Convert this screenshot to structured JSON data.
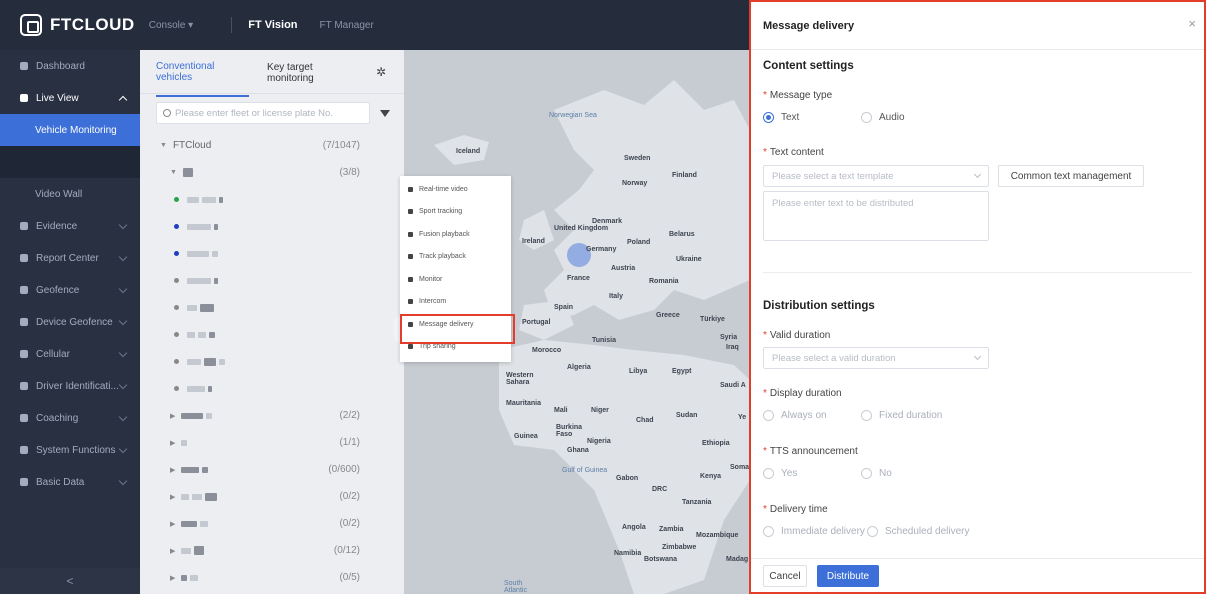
{
  "app": {
    "brand": "FTCLOUD",
    "console_label": "Console ▾",
    "nav_active": "FT Vision",
    "nav_other": "FT Manager"
  },
  "sidebar": {
    "items": [
      {
        "label": "Dashboard"
      },
      {
        "label": "Live View"
      },
      {
        "label": "Vehicle Monitoring"
      },
      {
        "label": "Video Wall"
      },
      {
        "label": "Evidence"
      },
      {
        "label": "Report Center"
      },
      {
        "label": "Geofence"
      },
      {
        "label": "Device Geofence"
      },
      {
        "label": "Cellular"
      },
      {
        "label": "Driver Identificati..."
      },
      {
        "label": "Coaching"
      },
      {
        "label": "System Functions"
      },
      {
        "label": "Basic Data"
      }
    ],
    "collapse_glyph": "<"
  },
  "vehicles": {
    "tabs": [
      "Conventional vehicles",
      "Key target monitoring"
    ],
    "search_placeholder": "Please enter fleet or license plate No.",
    "root": {
      "label": "FTCloud",
      "count": "(7/1047)"
    },
    "group_count": "(3/8)",
    "subgroups": [
      "(2/2)",
      "(1/1)",
      "(0/600)",
      "(0/2)",
      "(0/2)",
      "(0/12)",
      "(0/5)"
    ]
  },
  "context_menu": {
    "items": [
      {
        "label": "Real-time video"
      },
      {
        "label": "Sport tracking"
      },
      {
        "label": "Fusion playback"
      },
      {
        "label": "Track playback"
      },
      {
        "label": "Monitor"
      },
      {
        "label": "Intercom"
      },
      {
        "label": "Message delivery"
      },
      {
        "label": "Trip sharing"
      }
    ]
  },
  "map": {
    "labels": [
      {
        "text": "Norwegian Sea",
        "kind": "sea"
      },
      {
        "text": "Iceland",
        "kind": "land"
      },
      {
        "text": "Sweden",
        "kind": "land"
      },
      {
        "text": "Finland",
        "kind": "land"
      },
      {
        "text": "Norway",
        "kind": "land"
      },
      {
        "text": "United Kingdom",
        "kind": "land"
      },
      {
        "text": "Denmark",
        "kind": "land"
      },
      {
        "text": "Ireland",
        "kind": "land"
      },
      {
        "text": "Belarus",
        "kind": "land"
      },
      {
        "text": "Poland",
        "kind": "land"
      },
      {
        "text": "Germany",
        "kind": "land"
      },
      {
        "text": "Ukraine",
        "kind": "land"
      },
      {
        "text": "Austria",
        "kind": "land"
      },
      {
        "text": "France",
        "kind": "land"
      },
      {
        "text": "Romania",
        "kind": "land"
      },
      {
        "text": "Italy",
        "kind": "land"
      },
      {
        "text": "Spain",
        "kind": "land"
      },
      {
        "text": "Portugal",
        "kind": "land"
      },
      {
        "text": "Greece",
        "kind": "land"
      },
      {
        "text": "Türkiye",
        "kind": "land"
      },
      {
        "text": "Tunisia",
        "kind": "land"
      },
      {
        "text": "Syria",
        "kind": "land"
      },
      {
        "text": "Iraq",
        "kind": "land"
      },
      {
        "text": "Morocco",
        "kind": "land"
      },
      {
        "text": "Algeria",
        "kind": "land"
      },
      {
        "text": "Libya",
        "kind": "land"
      },
      {
        "text": "Egypt",
        "kind": "land"
      },
      {
        "text": "Western Sahara",
        "kind": "land"
      },
      {
        "text": "Saudi A",
        "kind": "land"
      },
      {
        "text": "Mauritania",
        "kind": "land"
      },
      {
        "text": "Mali",
        "kind": "land"
      },
      {
        "text": "Niger",
        "kind": "land"
      },
      {
        "text": "Chad",
        "kind": "land"
      },
      {
        "text": "Sudan",
        "kind": "land"
      },
      {
        "text": "Ye",
        "kind": "land"
      },
      {
        "text": "Burkina Faso",
        "kind": "land"
      },
      {
        "text": "Guinea",
        "kind": "land"
      },
      {
        "text": "Nigeria",
        "kind": "land"
      },
      {
        "text": "Ghana",
        "kind": "land"
      },
      {
        "text": "Ethiopia",
        "kind": "land"
      },
      {
        "text": "Gulf of Guinea",
        "kind": "sea"
      },
      {
        "text": "Soma",
        "kind": "land"
      },
      {
        "text": "Gabon",
        "kind": "land"
      },
      {
        "text": "Kenya",
        "kind": "land"
      },
      {
        "text": "DRC",
        "kind": "land"
      },
      {
        "text": "Tanzania",
        "kind": "land"
      },
      {
        "text": "Angola",
        "kind": "land"
      },
      {
        "text": "Zambia",
        "kind": "land"
      },
      {
        "text": "Mozambique",
        "kind": "land"
      },
      {
        "text": "Namibia",
        "kind": "land"
      },
      {
        "text": "Zimbabwe",
        "kind": "land"
      },
      {
        "text": "Botswana",
        "kind": "land"
      },
      {
        "text": "Madag",
        "kind": "land"
      },
      {
        "text": "South Atlantic",
        "kind": "sea"
      }
    ]
  },
  "drawer": {
    "title": "Message delivery",
    "close_glyph": "×",
    "content_section": "Content settings",
    "message_type_label": "Message type",
    "message_type_options": [
      "Text",
      "Audio"
    ],
    "text_content_label": "Text content",
    "template_placeholder": "Please select a text template",
    "common_text_button": "Common text management",
    "text_placeholder": "Please enter text to be distributed",
    "distribution_section": "Distribution settings",
    "valid_duration_label": "Valid duration",
    "valid_duration_placeholder": "Please select a valid duration",
    "display_duration_label": "Display duration",
    "display_duration_options": [
      "Always on",
      "Fixed duration"
    ],
    "tts_label": "TTS announcement",
    "tts_options": [
      "Yes",
      "No"
    ],
    "delivery_time_label": "Delivery time",
    "delivery_time_options": [
      "Immediate delivery",
      "Scheduled delivery"
    ],
    "cancel_button": "Cancel",
    "distribute_button": "Distribute",
    "required_mark": "*"
  },
  "colors": {
    "accent": "#3d6fd8",
    "highlight": "#e23c2b",
    "sidebar": "#283041"
  }
}
